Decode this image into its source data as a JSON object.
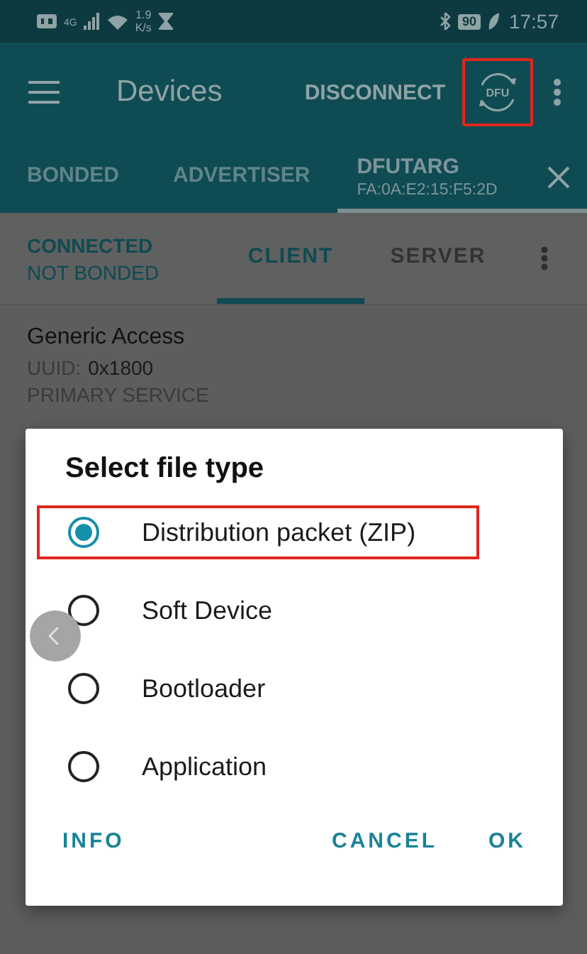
{
  "status_bar": {
    "network": "4G",
    "speed": "1.9",
    "speed_unit": "K/s",
    "battery": "90",
    "time": "17:57"
  },
  "toolbar": {
    "title": "Devices",
    "action": "DISCONNECT",
    "dfu_label": "DFU",
    "dfu_highlighted": true
  },
  "device_tabs": [
    {
      "label": "BONDED",
      "selected": false
    },
    {
      "label": "ADVERTISER",
      "selected": false
    },
    {
      "label": "DFUTARG",
      "subtitle": "FA:0A:E2:15:F5:2D",
      "selected": true
    }
  ],
  "connection": {
    "state": "CONNECTED",
    "bond": "NOT BONDED"
  },
  "role_tabs": [
    {
      "label": "CLIENT",
      "selected": true
    },
    {
      "label": "SERVER",
      "selected": false
    }
  ],
  "service": {
    "name": "Generic Access",
    "uuid_label": "UUID:",
    "uuid": "0x1800",
    "type": "PRIMARY SERVICE"
  },
  "dialog": {
    "title": "Select file type",
    "options": [
      {
        "label": "Distribution packet (ZIP)",
        "selected": true,
        "highlighted": true
      },
      {
        "label": "Soft Device",
        "selected": false,
        "highlighted": false
      },
      {
        "label": "Bootloader",
        "selected": false,
        "highlighted": false
      },
      {
        "label": "Application",
        "selected": false,
        "highlighted": false
      }
    ],
    "buttons": [
      {
        "label": "INFO",
        "kind": "left"
      },
      {
        "label": "CANCEL",
        "kind": "right"
      },
      {
        "label": "OK",
        "kind": "right"
      }
    ]
  }
}
